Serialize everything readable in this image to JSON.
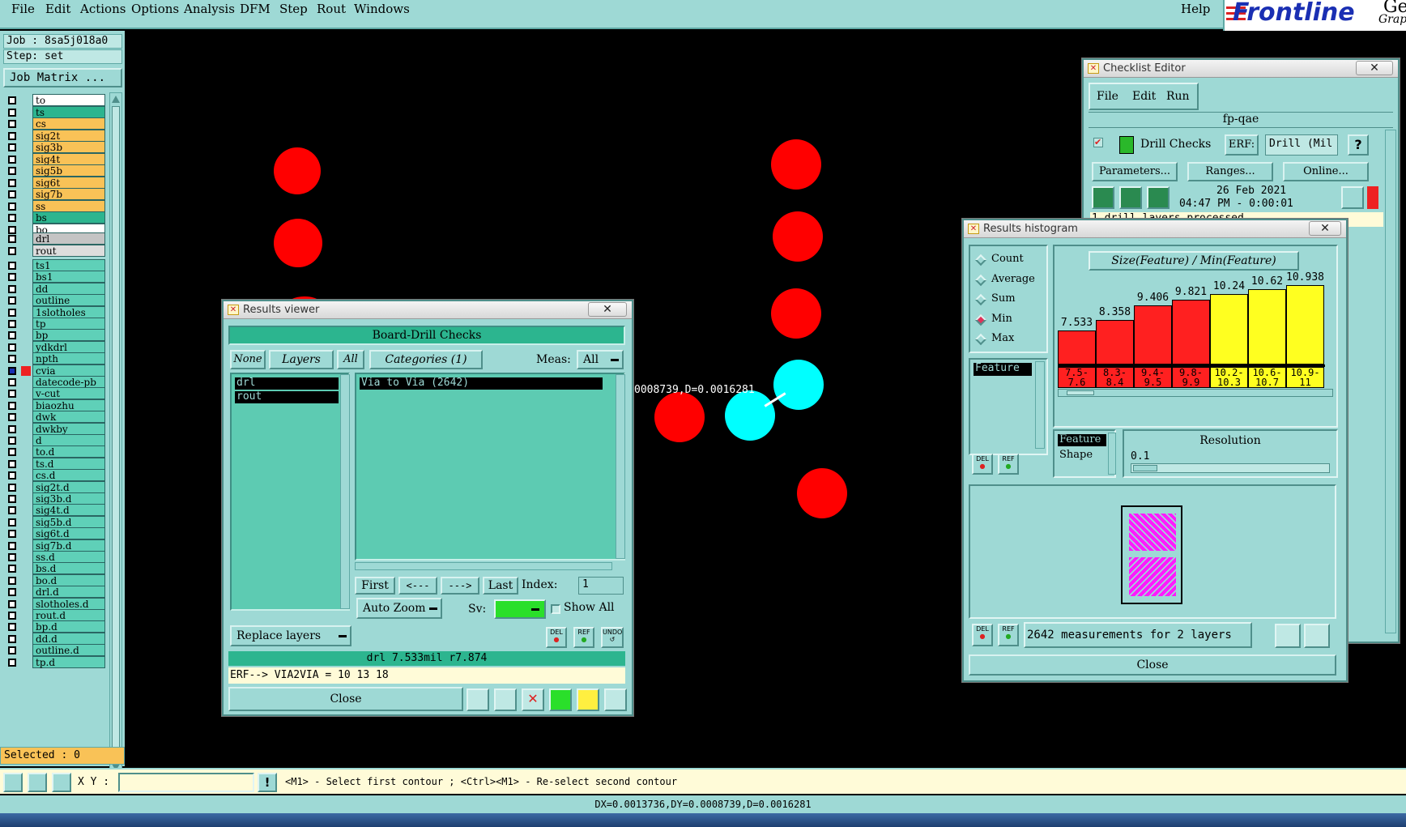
{
  "menu": {
    "items": [
      "File",
      "Edit",
      "Actions",
      "Options",
      "Analysis",
      "DFM",
      "Step",
      "Rout",
      "Windows"
    ],
    "help": "Help",
    "brand": "Frontline",
    "brand_suffix": "Gene",
    "brand_sub": "Graph"
  },
  "left_panel": {
    "job": "Job : 8sa5j018a0",
    "step": "Step: set",
    "job_matrix": "Job Matrix ...",
    "layers_group1": [
      {
        "name": "to",
        "color": "#ffffff"
      },
      {
        "name": "ts",
        "color": "#2cb58f"
      },
      {
        "name": "cs",
        "color": "#f9c257"
      },
      {
        "name": "sig2t",
        "color": "#f9c257"
      },
      {
        "name": "sig3b",
        "color": "#f9c257"
      },
      {
        "name": "sig4t",
        "color": "#f9c257"
      },
      {
        "name": "sig5b",
        "color": "#f9c257"
      },
      {
        "name": "sig6t",
        "color": "#f9c257"
      },
      {
        "name": "sig7b",
        "color": "#f9c257"
      },
      {
        "name": "ss",
        "color": "#f9c257"
      },
      {
        "name": "bs",
        "color": "#2cb58f"
      },
      {
        "name": "bo",
        "color": "#ffffff"
      }
    ],
    "layers_group2": [
      {
        "name": "drl",
        "color": "#c4c4c4"
      },
      {
        "name": "rout",
        "color": "#dddddd"
      }
    ],
    "layers_group3": [
      "ts1",
      "bs1",
      "dd",
      "outline",
      "1slotholes",
      "tp",
      "bp",
      "ydkdrl",
      "npth",
      "cvia",
      "datecode-pb",
      "v-cut",
      "biaozhu",
      "dwk",
      "dwkby",
      "d",
      "to.d",
      "ts.d",
      "cs.d",
      "sig2t.d",
      "sig3b.d",
      "sig4t.d",
      "sig5b.d",
      "sig6t.d",
      "sig7b.d",
      "ss.d",
      "bs.d",
      "bo.d",
      "drl.d",
      "slotholes.d",
      "rout.d",
      "bp.d",
      "dd.d",
      "outline.d",
      "tp.d"
    ],
    "selected": "Selected : 0"
  },
  "canvas": {
    "measure_text": "0008739,D=0.0016281"
  },
  "results_viewer": {
    "title": "Results viewer",
    "header": "Board-Drill Checks",
    "none": "None",
    "layers": "Layers",
    "all": "All",
    "categories": "Categories (1)",
    "meas_label": "Meas:",
    "meas_value": "All",
    "layer_list": [
      "drl",
      "rout"
    ],
    "category_list": [
      "Via to Via  (2642)"
    ],
    "first": "First",
    "prev": "<---",
    "next": "--->",
    "last": "Last",
    "index_label": "Index:",
    "index_value": "1",
    "auto_zoom": "Auto Zoom",
    "sv_label": "Sv:",
    "show_all": "Show All",
    "replace_layers": "Replace layers",
    "del": "DEL",
    "ref": "REF",
    "undo": "UNDO",
    "info": "drl 7.533mil  r7.874",
    "erf": "ERF--> VIA2VIA = 10 13 18",
    "close": "Close"
  },
  "checklist_editor": {
    "title": "Checklist Editor",
    "menu": [
      "File",
      "Edit",
      "Run"
    ],
    "name": "fp-qae",
    "check": "Drill Checks",
    "erf_label": "ERF:",
    "erf_value": "Drill (Mil",
    "help": "?",
    "parameters": "Parameters...",
    "ranges": "Ranges...",
    "online": "Online...",
    "date": "26 Feb 2021",
    "time": "04:47 PM - 0:00:01",
    "status": "1 drill layers processed"
  },
  "histogram": {
    "title": "Results histogram",
    "modes": [
      "Count",
      "Average",
      "Sum",
      "Min",
      "Max"
    ],
    "selected_mode": "Min",
    "group_by": "Feature",
    "chart_title": "Size(Feature) / Min(Feature)",
    "values": [
      7.533,
      8.358,
      9.406,
      9.821,
      10.24,
      10.62,
      10.938
    ],
    "value_labels": [
      "7.533",
      "8.358",
      "9.406",
      "9.821",
      "10.24",
      "10.62",
      "10.938"
    ],
    "bins_top": [
      "7.5-",
      "8.3-",
      "9.4-",
      "9.8-",
      "10.2-",
      "10.6-",
      "10.9-"
    ],
    "bins_bottom": [
      "7.6",
      "8.4",
      "9.5",
      "9.9",
      "10.3",
      "10.7",
      "11"
    ],
    "bar_colors": [
      "#ff2020",
      "#ff2020",
      "#ff2020",
      "#ff2020",
      "#ffff20",
      "#ffff20",
      "#ffff20"
    ],
    "attributes": [
      "Feature",
      "Shape"
    ],
    "selected_attribute": "Feature",
    "resolution_label": "Resolution",
    "resolution_value": "0.1",
    "measurements": "2642 measurements for 2 layers",
    "del": "DEL",
    "ref": "REF",
    "close": "Close"
  },
  "status": {
    "xy_label": "X Y :",
    "xy_value": "",
    "hint": "<M1> - Select first contour ; <Ctrl><M1> - Re-select second contour",
    "coords": "DX=0.0013736,DY=0.0008739,D=0.0016281"
  }
}
